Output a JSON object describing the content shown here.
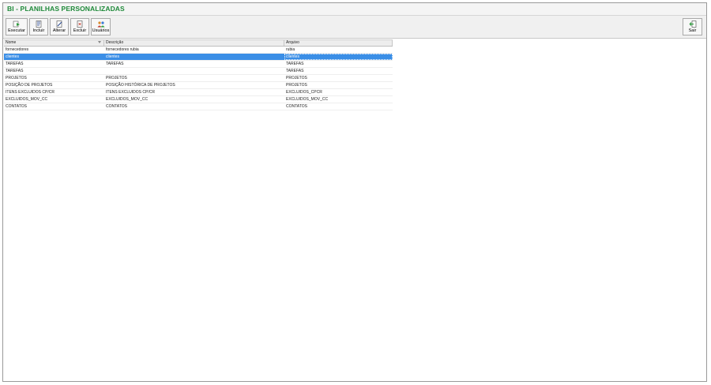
{
  "window": {
    "title": "BI - PLANILHAS PERSONALIZADAS"
  },
  "toolbar": {
    "buttons": [
      {
        "label": "Executar",
        "icon": "run-icon"
      },
      {
        "label": "Incluir",
        "icon": "add-document-icon"
      },
      {
        "label": "Alterar",
        "icon": "edit-document-icon"
      },
      {
        "label": "Excluir",
        "icon": "delete-document-icon"
      },
      {
        "label": "Usuários",
        "icon": "users-icon"
      }
    ],
    "exit": {
      "label": "Sair",
      "icon": "exit-icon"
    }
  },
  "grid": {
    "columns": [
      "Nome",
      "Descrição",
      "Arquivo"
    ],
    "rows": [
      [
        "fornecedores",
        "fornecedores rubia",
        "rubia"
      ],
      [
        "clientes",
        "clientes",
        "clientes"
      ],
      [
        "TAREFAS",
        "TAREFAS",
        "TAREFAS"
      ],
      [
        "TAREFAS",
        "",
        "TAREFAS"
      ],
      [
        "PROJETOS",
        "PROJETOS",
        "PROJETOS"
      ],
      [
        "POSIÇÃO DE PROJETOS",
        "POSIÇÃO HISTÓRICA DE PROJETOS",
        "PROJETOS"
      ],
      [
        "ITENS EXCLUIDOS CP/CR",
        "ITENS EXCLUIDOS CP/CR",
        "EXCLUIDOS_CPCR"
      ],
      [
        "EXCLUIDOS_MOV_CC",
        "EXCLUIDOS_MOV_CC",
        "EXCLUIDOS_MOV_CC"
      ],
      [
        "CONTATOS",
        "CONTATOS",
        "CONTATOS"
      ]
    ],
    "selected_row": 1
  },
  "colors": {
    "title": "#1f8a3a",
    "selection": "#3a8ee6"
  }
}
